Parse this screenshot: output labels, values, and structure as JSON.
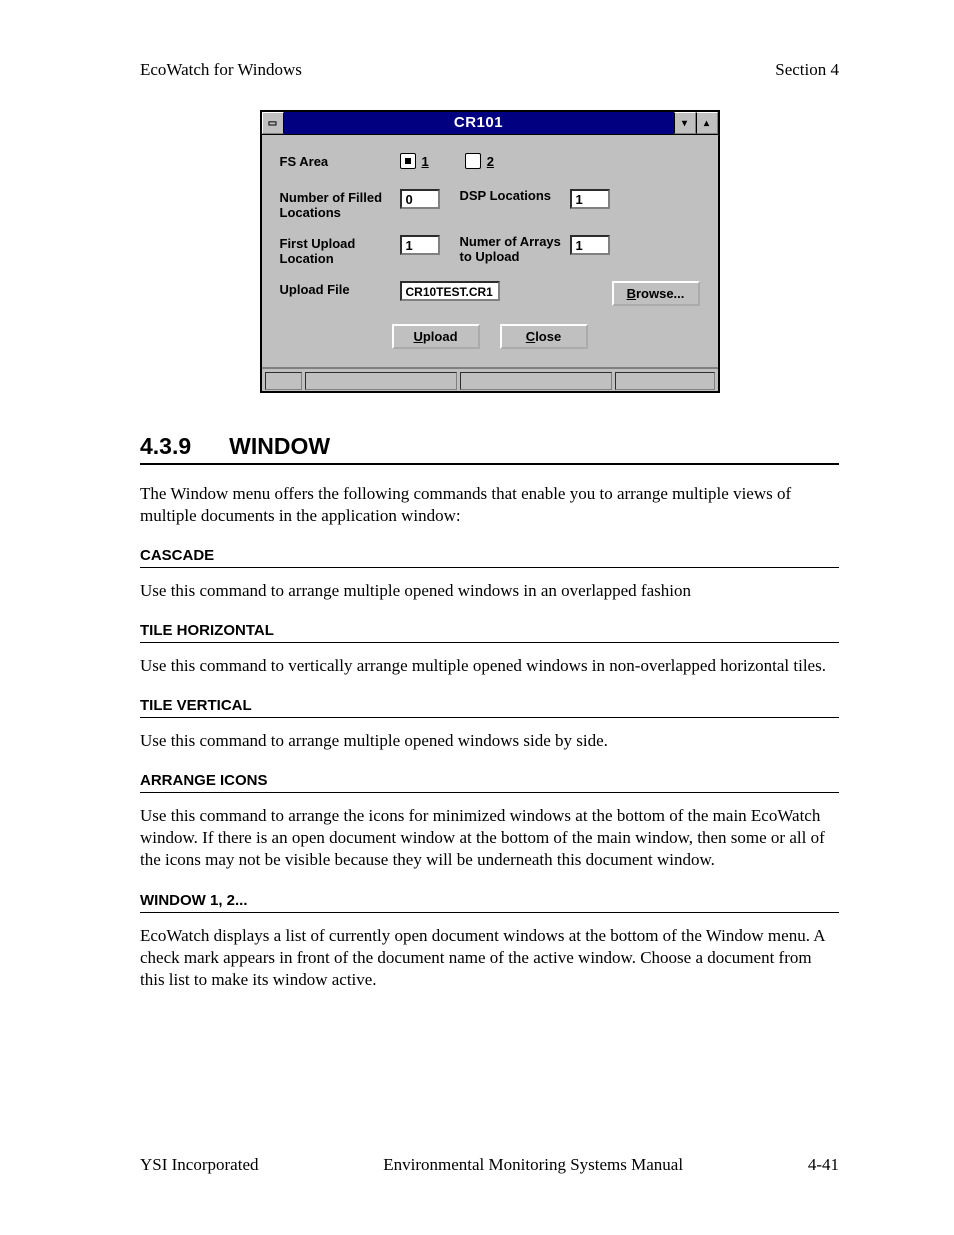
{
  "header": {
    "left": "EcoWatch for Windows",
    "right": "Section 4"
  },
  "dialog": {
    "title": "CR101",
    "labels": {
      "fs_area": "FS Area",
      "radio1": "1",
      "radio2": "2",
      "num_filled": "Number of Filled Locations",
      "dsp_loc": "DSP Locations",
      "first_upload": "First Upload Location",
      "num_arrays": "Numer of Arrays to Upload",
      "upload_file": "Upload File"
    },
    "values": {
      "num_filled": "0",
      "dsp_loc": "1",
      "first_upload": "1",
      "num_arrays": "1",
      "upload_file": "CR10TEST.CR1"
    },
    "buttons": {
      "browse": "Browse...",
      "upload": "Upload",
      "close": "Close"
    }
  },
  "section": {
    "num": "4.3.9",
    "title": "WINDOW",
    "intro": "The Window menu offers the following commands that enable you to arrange multiple views of multiple documents in the application window:"
  },
  "subs": {
    "cascade": {
      "h": "CASCADE",
      "p": "Use this command to arrange multiple opened windows in an overlapped fashion"
    },
    "tileh": {
      "h": "TILE HORIZONTAL",
      "p": "Use this command to vertically arrange multiple opened windows in non-overlapped horizontal tiles."
    },
    "tilev": {
      "h": "TILE VERTICAL",
      "p": "Use this command to arrange multiple opened windows side by side."
    },
    "arrange": {
      "h": "ARRANGE ICONS",
      "p": "Use this command to arrange the icons for minimized windows at the bottom of the main EcoWatch window.  If there is an open document window at the bottom of the main window, then some or all of the icons may not be visible because they will be underneath this document window."
    },
    "winlist": {
      "h": "WINDOW 1, 2...",
      "p": "EcoWatch displays a list of currently open document windows at the bottom of the Window menu.  A check mark appears in front of the document name of the active window.  Choose a document from this list to make its window active."
    }
  },
  "footer": {
    "left": "YSI Incorporated",
    "mid": "Environmental Monitoring Systems Manual",
    "right": "4-41"
  }
}
